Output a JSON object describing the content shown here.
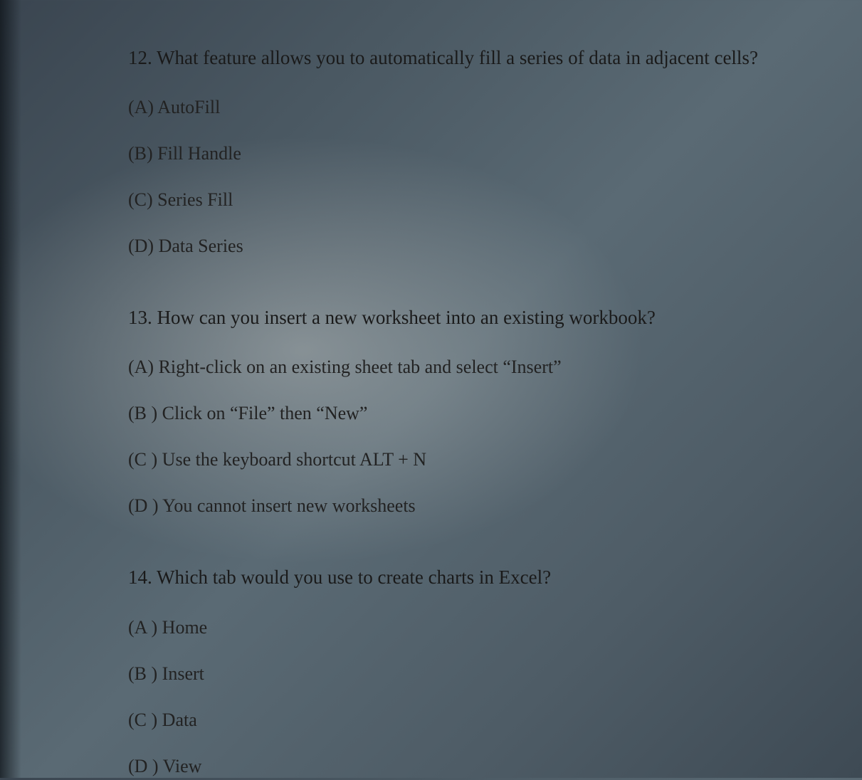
{
  "questions": [
    {
      "number": "12.",
      "text": "What feature allows you to automatically fill a series of data in adjacent cells?",
      "options": [
        {
          "label": "(A)",
          "text": "AutoFill"
        },
        {
          "label": "(B)",
          "text": "Fill Handle"
        },
        {
          "label": "(C)",
          "text": "Series Fill"
        },
        {
          "label": "(D)",
          "text": "Data Series"
        }
      ]
    },
    {
      "number": "13.",
      "text": "How can you insert a new worksheet into an existing workbook?",
      "options": [
        {
          "label": "(A)",
          "text": "Right-click on an existing sheet tab and select “Insert”"
        },
        {
          "label": "(B )",
          "text": "Click on “File” then “New”"
        },
        {
          "label": "(C )",
          "text": "Use the keyboard shortcut ALT + N"
        },
        {
          "label": "(D )",
          "text": "You cannot insert new worksheets"
        }
      ]
    },
    {
      "number": "14.",
      "text": "Which tab would you use to create charts in Excel?",
      "options": [
        {
          "label": "(A )",
          "text": "Home"
        },
        {
          "label": "(B )",
          "text": "Insert"
        },
        {
          "label": "(C )",
          "text": "Data"
        },
        {
          "label": "(D )",
          "text": "View"
        }
      ]
    }
  ]
}
